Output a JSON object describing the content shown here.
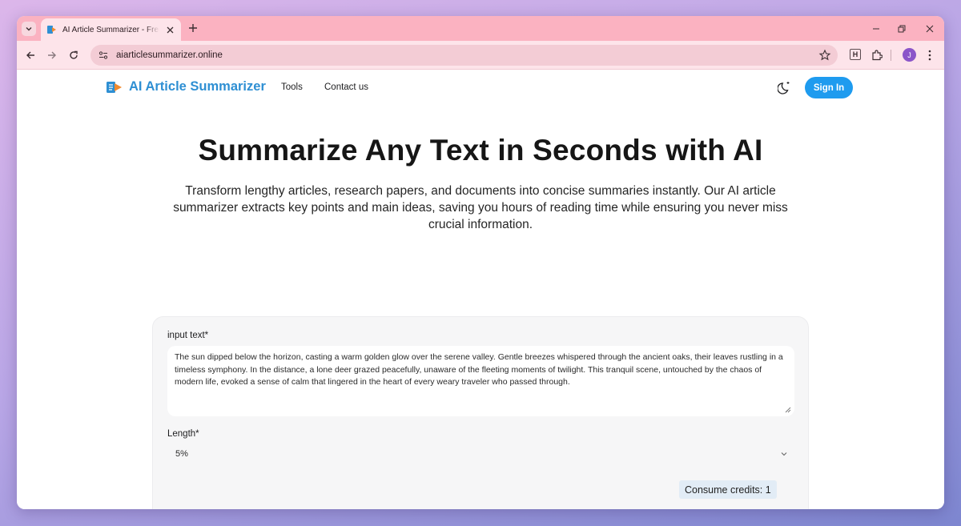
{
  "browser": {
    "tab_title": "AI Article Summarizer - Free Text Summarizer",
    "url": "aiarticlesummarizer.online",
    "profile_initial": "J",
    "extension_letter": "H"
  },
  "navbar": {
    "brand": "AI Article Summarizer",
    "links": [
      "Tools",
      "Contact us"
    ],
    "sign_in": "Sign In"
  },
  "hero": {
    "title": "Summarize Any Text in Seconds with AI",
    "subtitle": "Transform lengthy articles, research papers, and documents into concise summaries instantly. Our AI article summarizer extracts key points and main ideas, saving you hours of reading time while ensuring you never miss crucial information."
  },
  "form": {
    "input_label": "input text*",
    "input_value": "The sun dipped below the horizon, casting a warm golden glow over the serene valley. Gentle breezes whispered through the ancient oaks, their leaves rustling in a timeless symphony. In the distance, a lone deer grazed peacefully, unaware of the fleeting moments of twilight. This tranquil scene, untouched by the chaos of modern life, evoked a sense of calm that lingered in the heart of every weary traveler who passed through.",
    "length_label": "Length*",
    "length_value": "5%",
    "credits": "Consume credits: 1"
  },
  "colors": {
    "brand": "#2e8fd3",
    "sign_in_bg": "#1e9bef",
    "tabstrip": "#fbb2c1"
  }
}
